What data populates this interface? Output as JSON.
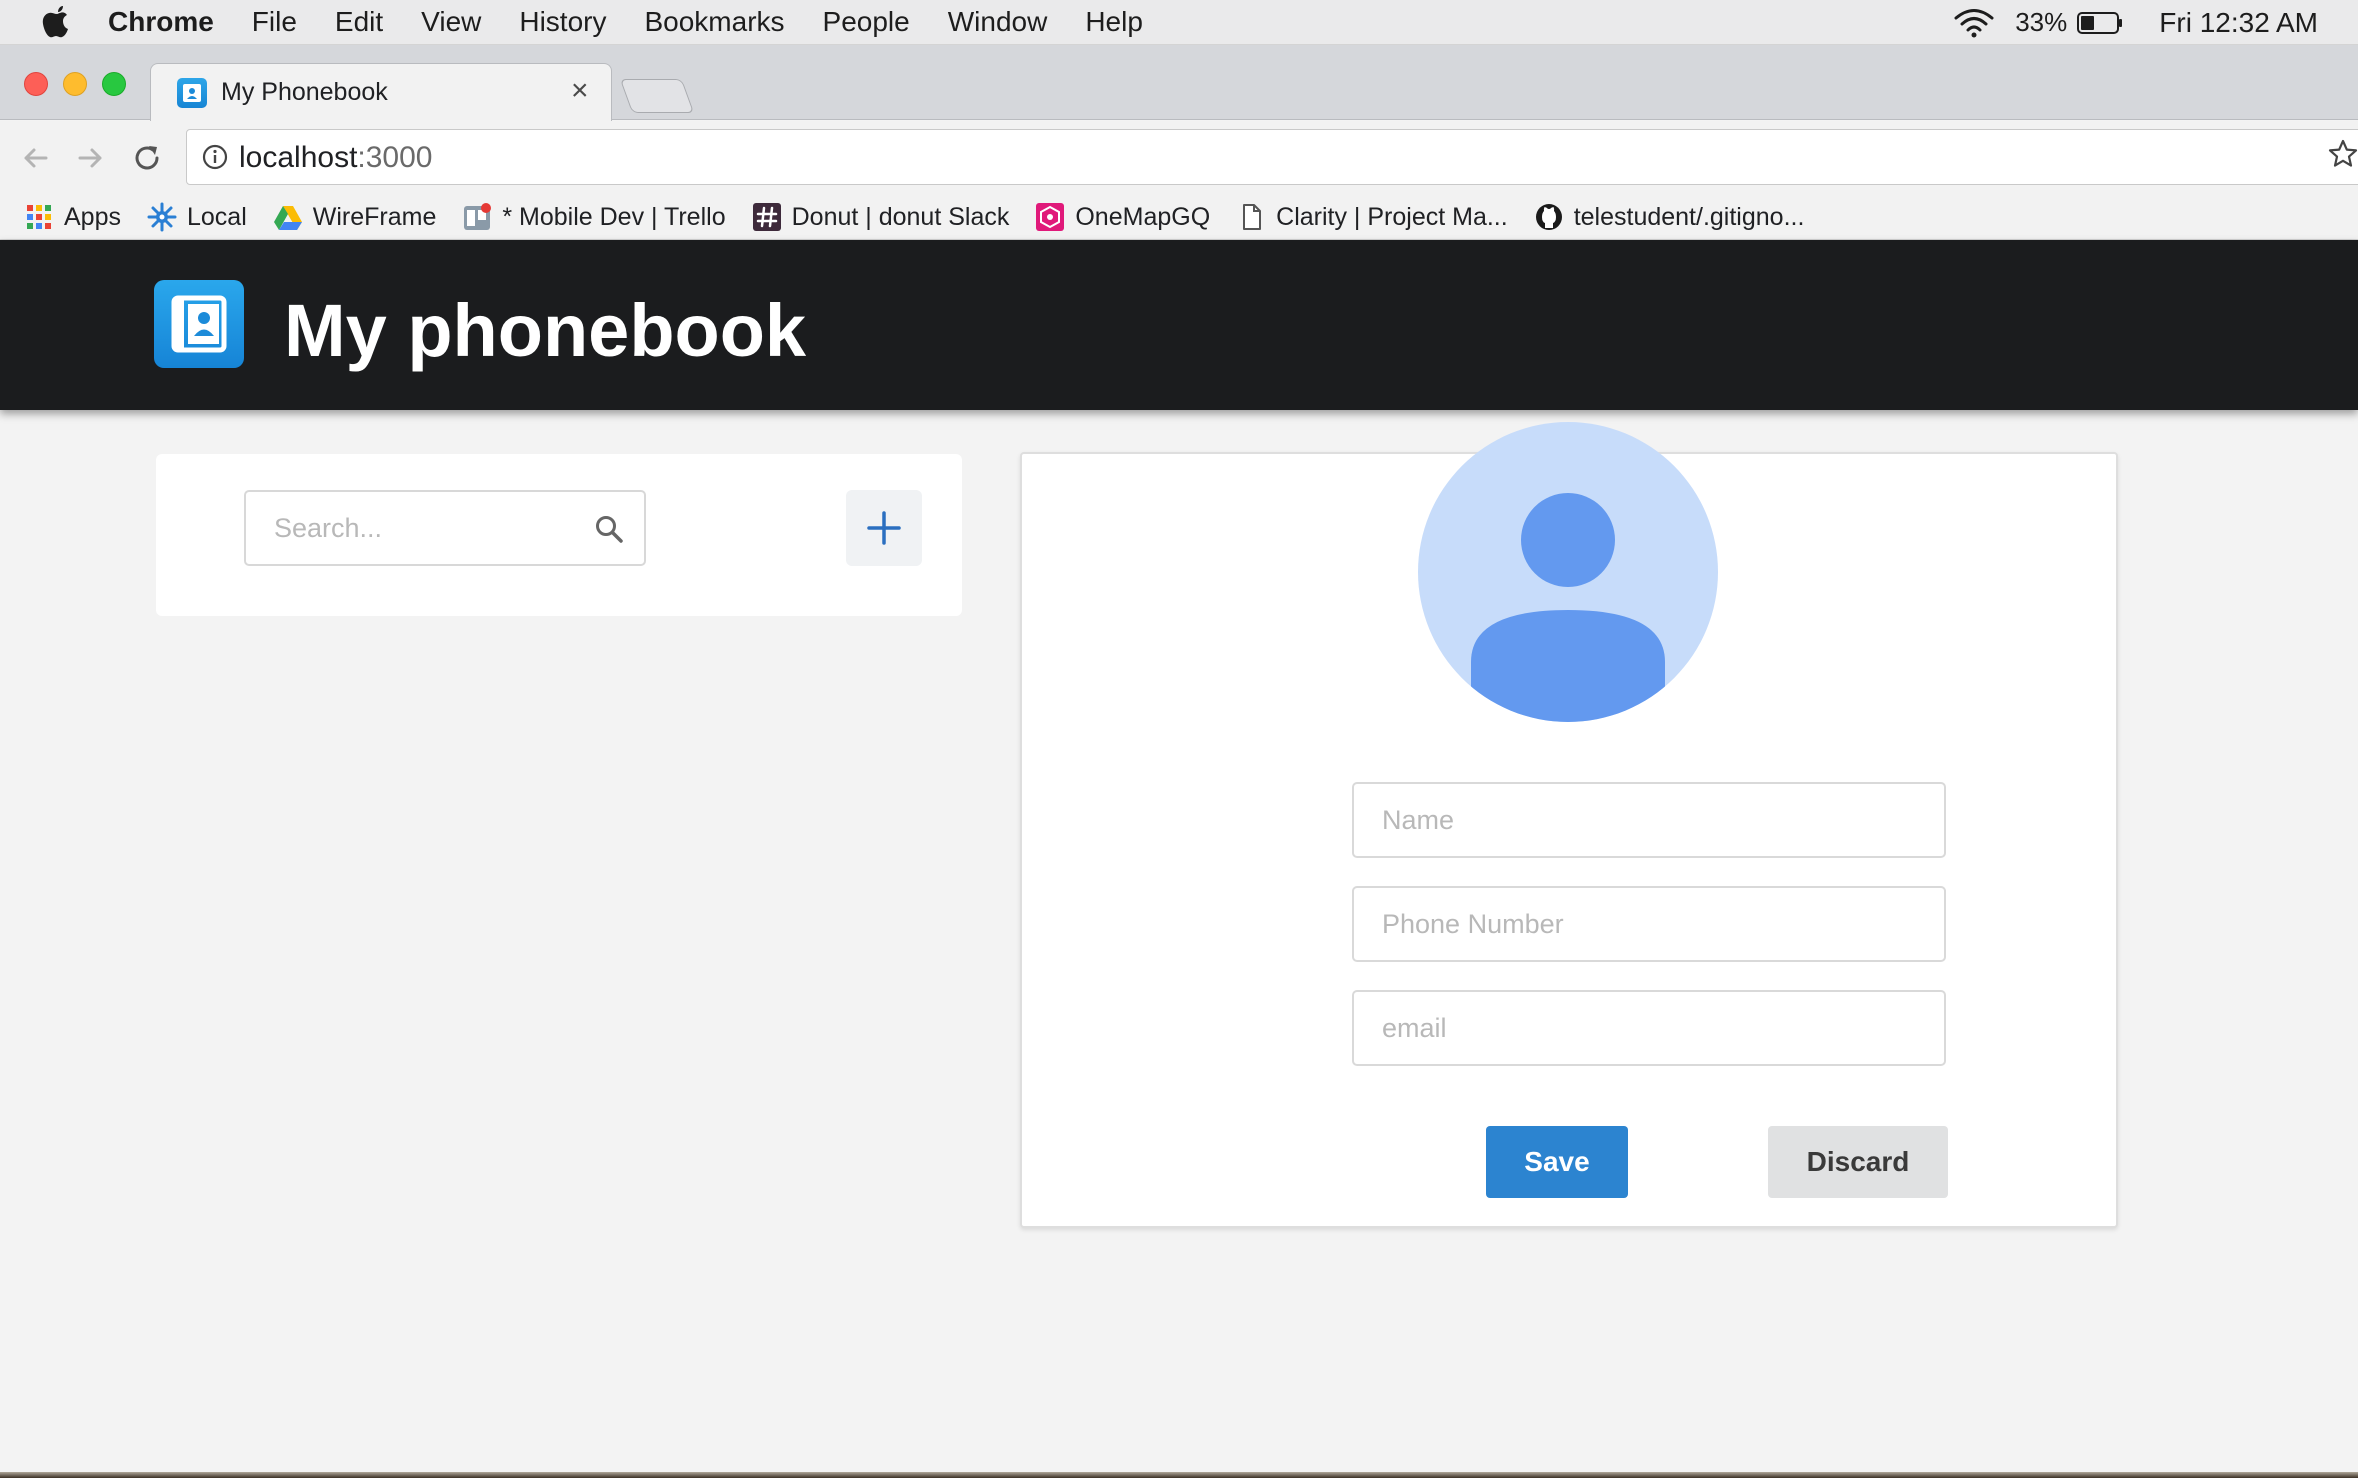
{
  "menubar": {
    "app": "Chrome",
    "items": [
      "File",
      "Edit",
      "View",
      "History",
      "Bookmarks",
      "People",
      "Window",
      "Help"
    ],
    "battery_percent": "33%",
    "clock": "Fri 12:32 AM"
  },
  "browser": {
    "tab_title": "My Phonebook",
    "tab_close": "×",
    "url_host": "localhost",
    "url_port": ":3000",
    "bookmarks": [
      {
        "label": "Apps",
        "icon": "apps-grid-icon"
      },
      {
        "label": "Local",
        "icon": "local-gear-icon"
      },
      {
        "label": "WireFrame",
        "icon": "google-drive-icon"
      },
      {
        "label": "* Mobile Dev | Trello",
        "icon": "trello-icon"
      },
      {
        "label": "Donut | donut Slack",
        "icon": "slack-hash-icon"
      },
      {
        "label": "OneMapGQ",
        "icon": "onemap-icon"
      },
      {
        "label": "Clarity | Project Ma...",
        "icon": "page-icon"
      },
      {
        "label": "telestudent/.gitigno...",
        "icon": "github-icon"
      }
    ]
  },
  "app": {
    "title": "My phonebook",
    "search": {
      "placeholder": "Search..."
    },
    "form": {
      "name_placeholder": "Name",
      "phone_placeholder": "Phone Number",
      "email_placeholder": "email"
    },
    "save_label": "Save",
    "discard_label": "Discard"
  },
  "colors": {
    "header_bg": "#1b1c1e",
    "accent_blue": "#2c84d0",
    "avatar_light": "#c7dcfa",
    "avatar_dark": "#6399ef"
  }
}
